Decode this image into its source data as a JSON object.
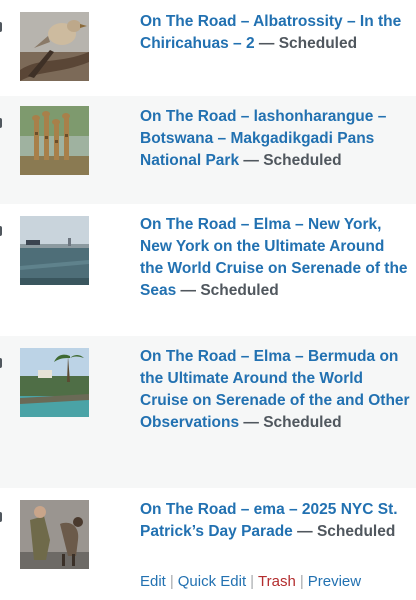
{
  "posts": [
    {
      "title": "On The Road – Albatrossity – In the Chiricahuas – 2",
      "status": "Scheduled",
      "thumb_icon": "bird-photo-icon"
    },
    {
      "title": "On The Road – lashonharangue – Botswana – Makgadikgadi Pans National Park",
      "status": "Scheduled",
      "thumb_icon": "giraffes-photo-icon"
    },
    {
      "title": "On The Road – Elma – New York, New York on the Ultimate Around the World Cruise on Serenade of the Seas",
      "status": "Scheduled",
      "thumb_icon": "harbor-photo-icon"
    },
    {
      "title": "On The Road – Elma – Bermuda on the Ultimate Around the World Cruise on Serenade of the and Other Observations",
      "status": "Scheduled",
      "thumb_icon": "bermuda-coast-photo-icon"
    },
    {
      "title": "On The Road – ema – 2025 NYC St. Patrick’s Day Parade",
      "status": "Scheduled",
      "thumb_icon": "parade-photo-icon"
    }
  ],
  "separator": "—",
  "row_actions": {
    "edit": "Edit",
    "quick_edit": "Quick Edit",
    "trash": "Trash",
    "preview": "Preview"
  },
  "colors": {
    "link": "#2271b1",
    "trash": "#b32d2e",
    "alt_row": "#f6f7f7",
    "status_text": "#50575e"
  }
}
